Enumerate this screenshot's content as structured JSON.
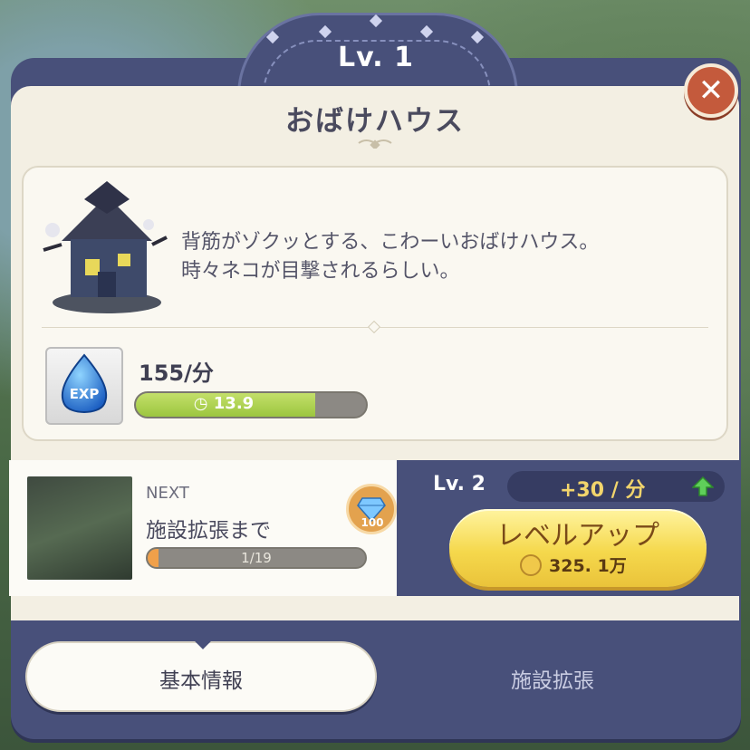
{
  "header": {
    "level_label": "Lv. 1",
    "facility_name": "おばけハウス"
  },
  "close": {
    "glyph": "✕"
  },
  "info": {
    "description_line1": "背筋がゾクッとする、こわーいおばけハウス。",
    "description_line2": "時々ネコが目撃されるらしい。",
    "exp_icon_text": "EXP",
    "rate": "155/分",
    "timer": "13.9",
    "timer_progress": 0.78
  },
  "next": {
    "label": "NEXT",
    "target": "施設拡張まで",
    "progress_text": "1/19",
    "progress": 0.05,
    "gem_count": "100"
  },
  "upgrade": {
    "next_level": "Lv. 2",
    "gain": "+30 / 分",
    "button_label": "レベルアップ",
    "cost": "325. 1万"
  },
  "tabs": [
    {
      "label": "基本情報",
      "active": true
    },
    {
      "label": "施設拡張",
      "active": false
    }
  ],
  "colors": {
    "panel": "#48507a",
    "card": "#faf8f1",
    "close": "#c45a3c",
    "exp_bar": "#9cc63f",
    "next_bar": "#f0a04a",
    "button": "#f5d84c"
  }
}
